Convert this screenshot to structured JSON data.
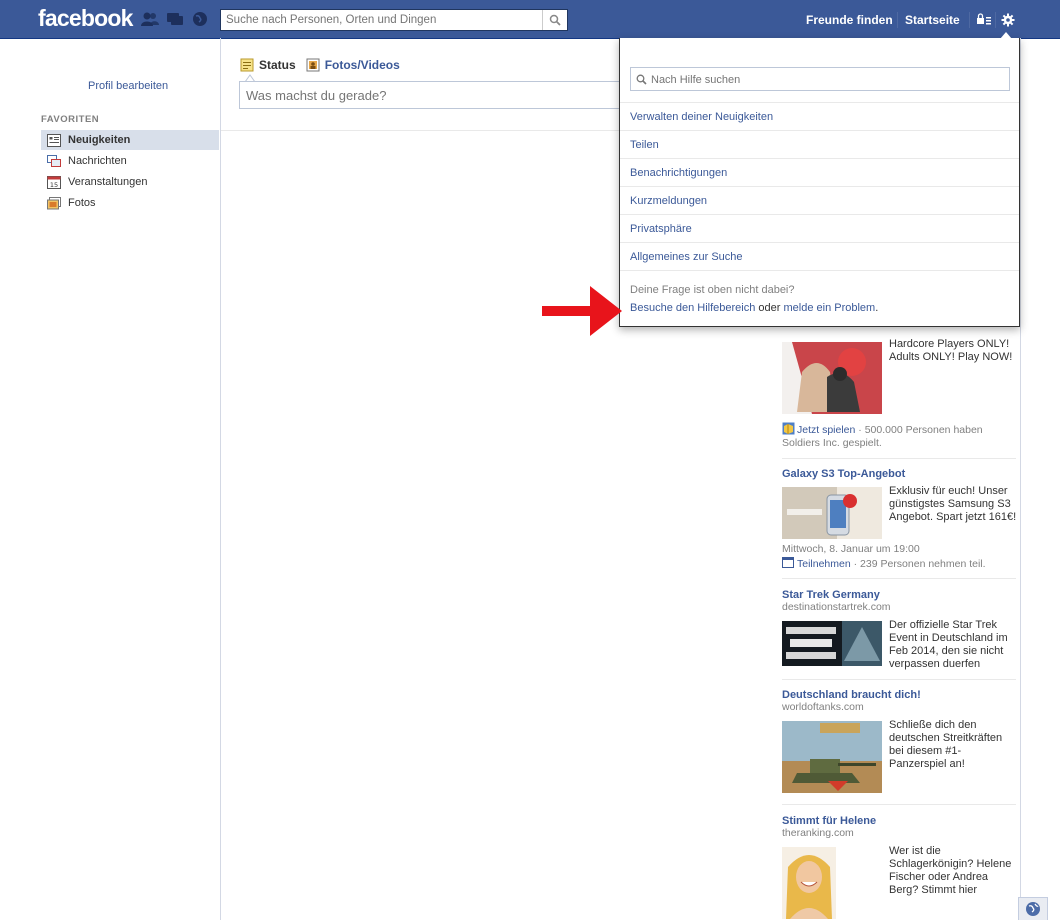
{
  "topbar": {
    "logo": "facebook",
    "search_placeholder": "Suche nach Personen, Orten und Dingen",
    "find_friends": "Freunde finden",
    "home": "Startseite",
    "icons": [
      "friend-requests-icon",
      "messages-icon",
      "notifications-globe-icon",
      "search-icon",
      "privacy-lock-icon",
      "gear-icon"
    ],
    "colors": {
      "bar": "#3b5998",
      "link": "#3b5998"
    }
  },
  "left_nav": {
    "edit_profile": "Profil bearbeiten",
    "favorites_header": "FAVORITEN",
    "items": [
      {
        "label": "Neuigkeiten",
        "icon": "news-feed-icon",
        "active": true
      },
      {
        "label": "Nachrichten",
        "icon": "messages-icon",
        "active": false
      },
      {
        "label": "Veranstaltungen",
        "icon": "calendar-icon",
        "active": false
      },
      {
        "label": "Fotos",
        "icon": "photos-icon",
        "active": false
      }
    ]
  },
  "composer": {
    "tab_status": "Status",
    "tab_photos": "Fotos/Videos",
    "placeholder": "Was machst du gerade?"
  },
  "help_menu": {
    "search_placeholder": "Nach Hilfe suchen",
    "items": [
      "Verwalten deiner Neuigkeiten",
      "Teilen",
      "Benachrichtigungen",
      "Kurzmeldungen",
      "Privatsphäre",
      "Allgemeines zur Suche"
    ],
    "question": "Deine Frage ist oben nicht dabei?",
    "footer_link1": "Besuche den Hilfebereich",
    "footer_mid": " oder ",
    "footer_link2": "melde ein Problem",
    "footer_end": "."
  },
  "ads": [
    {
      "text": "Hardcore Players ONLY! Adults ONLY! Play NOW!",
      "social_link": "Jetzt spielen",
      "social_text": " · 500.000 Personen haben Soldiers Inc. gespielt."
    },
    {
      "title": "Galaxy S3 Top-Angebot",
      "text": "Exklusiv für euch! Unser günstigstes Samsung S3 Angebot. Spart jetzt 161€!",
      "date": "Mittwoch, 8. Januar um 19:00",
      "social_link": "Teilnehmen",
      "social_text": " · 239 Personen nehmen teil."
    },
    {
      "title": "Star Trek Germany",
      "url": "destinationstartrek.com",
      "text": "Der offizielle Star Trek Event in Deutschland im Feb 2014, den sie nicht verpassen duerfen"
    },
    {
      "title": "Deutschland braucht dich!",
      "url": "worldoftanks.com",
      "text": "Schließe dich den deutschen Streitkräften bei diesem #1-Panzerspiel an!"
    },
    {
      "title": "Stimmt für Helene",
      "url": "theranking.com",
      "text": "Wer ist die Schlagerkönigin? Helene Fischer oder Andrea Berg? Stimmt hier"
    }
  ]
}
